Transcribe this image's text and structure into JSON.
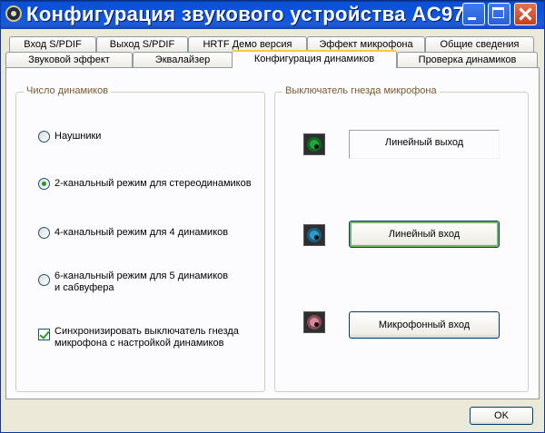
{
  "window": {
    "title": "Конфигурация звукового устройства AC97"
  },
  "tabs_row1": [
    {
      "label": "Вход S/PDIF"
    },
    {
      "label": "Выход S/PDIF"
    },
    {
      "label": "HRTF Демо версия"
    },
    {
      "label": "Эффект микрофона"
    },
    {
      "label": "Общие сведения"
    }
  ],
  "tabs_row2": [
    {
      "label": "Звуковой эффект"
    },
    {
      "label": "Эквалайзер"
    },
    {
      "label": "Конфигурация динамиков",
      "active": true
    },
    {
      "label": "Проверка динамиков"
    }
  ],
  "speaker_group": {
    "title": "Число динамиков",
    "options": [
      {
        "label": "Наушники",
        "checked": false
      },
      {
        "label": "2-канальный режим для стереодинамиков",
        "checked": true
      },
      {
        "label": "4-канальный режим для 4 динамиков",
        "checked": false
      },
      {
        "label": "6-канальный режим для 5 динамиков и сабвуфера",
        "checked": false
      }
    ],
    "sync": {
      "label": "Синхронизировать выключатель гнезда микрофона с настройкой динамиков",
      "checked": true
    }
  },
  "jack_group": {
    "title": "Выключатель гнезда микрофона",
    "jacks": [
      {
        "label": "Линейный выход",
        "icon": "line-out-jack-icon",
        "color": "#1FA83A"
      },
      {
        "label": "Линейный вход",
        "icon": "line-in-jack-icon",
        "color": "#2E9CCB"
      },
      {
        "label": "Микрофонный вход",
        "icon": "mic-in-jack-icon",
        "color": "#D88A9A"
      }
    ]
  },
  "footer": {
    "ok_label": "OK"
  }
}
